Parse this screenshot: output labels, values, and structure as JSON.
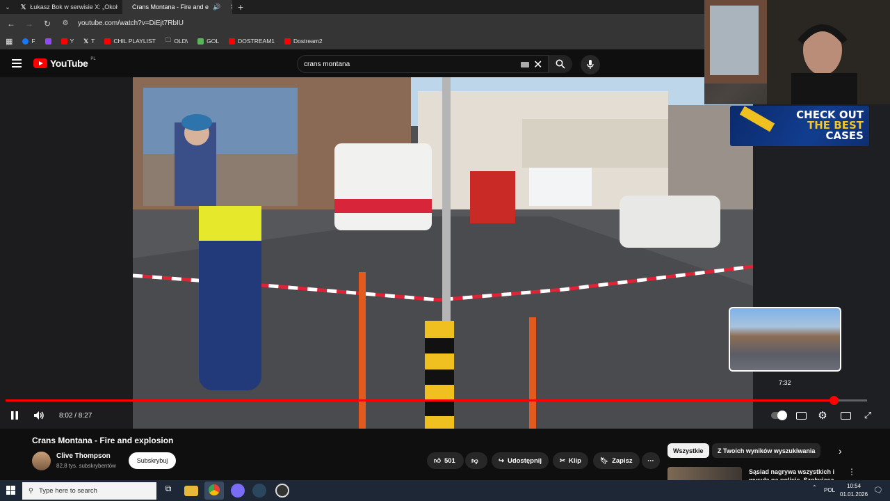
{
  "browser": {
    "tabs": [
      {
        "label": "Łukasz Bok w serwisie X: „Okoł",
        "icon": "x-logo-icon",
        "active": false
      },
      {
        "label": "Crans Montana - Fire and e",
        "icon": "youtube-icon",
        "active": true
      }
    ],
    "url": "youtube.com/watch?v=DiEjt7RbIU",
    "bookmarks": [
      {
        "label": "F",
        "color": "#1877f2"
      },
      {
        "label": "",
        "color": "#9146ff"
      },
      {
        "label": "Y",
        "color": "#ff0000"
      },
      {
        "label": "T",
        "color": "#ffffff"
      },
      {
        "label": "CHIL PLAYLIST",
        "color": "#ff0000"
      },
      {
        "label": "OLD\\",
        "color": "#cccccc"
      },
      {
        "label": "GOL",
        "color": "#5ab45a"
      },
      {
        "label": "DOSTREAM1",
        "color": "#ff0000"
      },
      {
        "label": "Dostream2",
        "color": "#ff0000"
      }
    ]
  },
  "youtube": {
    "logo_text": "YouTube",
    "region": "PL",
    "search_value": "crans montana"
  },
  "player": {
    "time_display": "8:02 / 8:27",
    "progress_fraction": 0.961,
    "hover_preview_time": "7:32",
    "hover_fraction": 0.906
  },
  "ad": {
    "line1": "CHECK OUT",
    "line2": "THE BEST",
    "line3": "CASES"
  },
  "video_info": {
    "title": "Crans Montana - Fire and explosion",
    "channel": "Clive Thompson",
    "subscribers": "82,8 tys. subskrybentów",
    "subscribe_label": "Subskrybuj",
    "likes": "501",
    "share_label": "Udostępnij",
    "clip_label": "Klip",
    "save_label": "Zapisz"
  },
  "recommendations": {
    "chips": [
      "Wszystkie",
      "Z Twoich wyników wyszukiwania"
    ],
    "first_title": "Sąsiad nagrywa wszystkich i wysyła na policję. Szokująca"
  },
  "taskbar": {
    "search_placeholder": "Type here to search",
    "language": "POL",
    "time": "10:54",
    "date": "01.01.2026"
  },
  "colors": {
    "accent": "#ff0000",
    "background": "#0f0f0f",
    "taskbar": "#1d2736"
  }
}
